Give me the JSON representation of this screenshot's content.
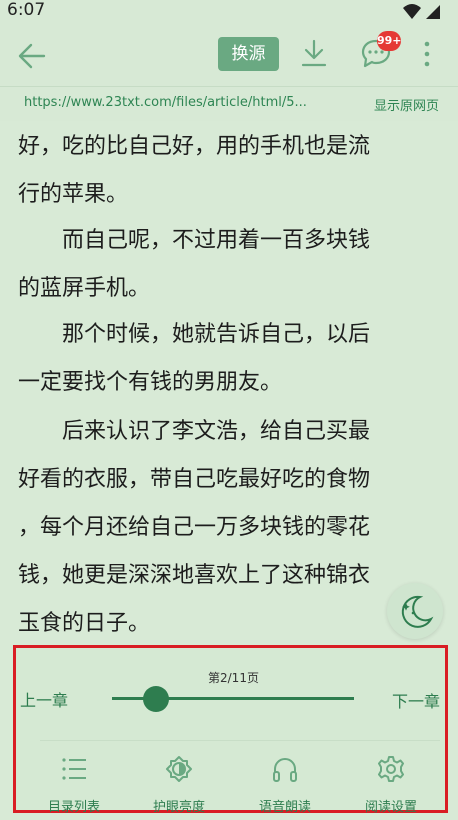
{
  "status": {
    "time": "6:07"
  },
  "toolbar": {
    "switch_source_label": "换源",
    "comment_badge": "99+"
  },
  "url_bar": {
    "url": "https://www.23txt.com/files/article/html/5...",
    "show_original_label": "显示原网页"
  },
  "content": {
    "paragraphs": [
      "好，吃的比自己好，用的手机也是流\n行的苹果。",
      "　　而自己呢，不过用着一百多块钱\n的蓝屏手机。",
      "　　那个时候，她就告诉自己，以后\n一定要找个有钱的男朋友。",
      "　　后来认识了李文浩，给自己买最\n好看的衣服，带自己吃最好吃的食物\n，每个月还给自己一万多块钱的零花\n钱，她更是深深地喜欢上了这种锦衣\n玉食的日子。"
    ]
  },
  "reader_panel": {
    "page_indicator": "第2/11页",
    "progress": 0.18,
    "prev_chapter_label": "上一章",
    "next_chapter_label": "下一章",
    "tools": [
      {
        "label": "目录列表",
        "icon": "list-icon"
      },
      {
        "label": "护眼亮度",
        "icon": "brightness-icon"
      },
      {
        "label": "语音朗读",
        "icon": "headphones-icon"
      },
      {
        "label": "阅读设置",
        "icon": "gear-icon"
      }
    ]
  },
  "colors": {
    "accent": "#2e7d4f",
    "background": "#d8ead6",
    "button": "#6aa982",
    "highlight_border": "#d91d24",
    "badge": "#e53935"
  }
}
